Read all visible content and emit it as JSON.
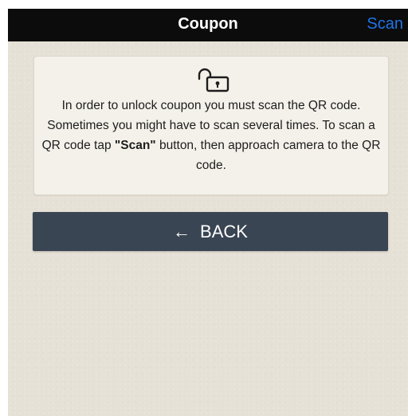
{
  "navbar": {
    "title": "Coupon",
    "scan_label": "Scan"
  },
  "info": {
    "icon": "unlocked-lock-icon",
    "text_before": "In order to unlock coupon you must scan the QR code. Sometimes you might have to scan several times. To scan a QR code tap ",
    "text_bold": "\"Scan\"",
    "text_after": " button, then approach camera to the QR code."
  },
  "back_button": {
    "arrow": "←",
    "label": "BACK"
  },
  "colors": {
    "navbar": "#0c0c0c",
    "accent": "#1f74e6",
    "background": "#e6e1d6",
    "card": "#f4f1ea",
    "button": "#3a4553"
  }
}
